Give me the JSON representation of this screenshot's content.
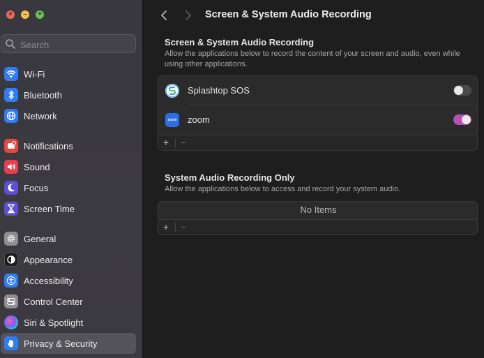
{
  "window": {
    "title": "Screen & System Audio Recording"
  },
  "search": {
    "placeholder": "Search"
  },
  "sidebar": {
    "items": [
      {
        "label": "Wi-Fi",
        "icon": "wifi-icon",
        "color": "#2f7df6"
      },
      {
        "label": "Bluetooth",
        "icon": "bluetooth-icon",
        "color": "#2f7df6"
      },
      {
        "label": "Network",
        "icon": "globe-icon",
        "color": "#2f7df6"
      },
      {
        "label": "Notifications",
        "icon": "bell-icon",
        "color": "#e5483f"
      },
      {
        "label": "Sound",
        "icon": "speaker-icon",
        "color": "#e5404f"
      },
      {
        "label": "Focus",
        "icon": "moon-icon",
        "color": "#5b4fd6"
      },
      {
        "label": "Screen Time",
        "icon": "hourglass-icon",
        "color": "#5b4fd6"
      },
      {
        "label": "General",
        "icon": "gear-icon",
        "color": "#8e8e93"
      },
      {
        "label": "Appearance",
        "icon": "appearance-icon",
        "color": "#1c1c1e"
      },
      {
        "label": "Accessibility",
        "icon": "accessibility-icon",
        "color": "#2f7df6"
      },
      {
        "label": "Control Center",
        "icon": "control-center-icon",
        "color": "#8e8e93"
      },
      {
        "label": "Siri & Spotlight",
        "icon": "siri-icon",
        "color": "#3a2a6a"
      },
      {
        "label": "Privacy & Security",
        "icon": "hand-icon",
        "color": "#2f7df6"
      }
    ],
    "selected": "Privacy & Security"
  },
  "main": {
    "section1": {
      "title": "Screen & System Audio Recording",
      "description": "Allow the applications below to record the content of your screen and audio, even while using other applications.",
      "apps": [
        {
          "name": "Splashtop SOS",
          "enabled": false,
          "icon": "splashtop-icon"
        },
        {
          "name": "zoom",
          "enabled": true,
          "icon": "zoom-icon",
          "icon_text": "zoom"
        }
      ],
      "add_label": "+",
      "remove_label": "−"
    },
    "section2": {
      "title": "System Audio Recording Only",
      "description": "Allow the applications below to access and record your system audio.",
      "empty_text": "No Items",
      "add_label": "+",
      "remove_label": "−"
    }
  },
  "colors": {
    "toggle_on": "#b650b9",
    "sidebar_selected": "#55535a"
  }
}
